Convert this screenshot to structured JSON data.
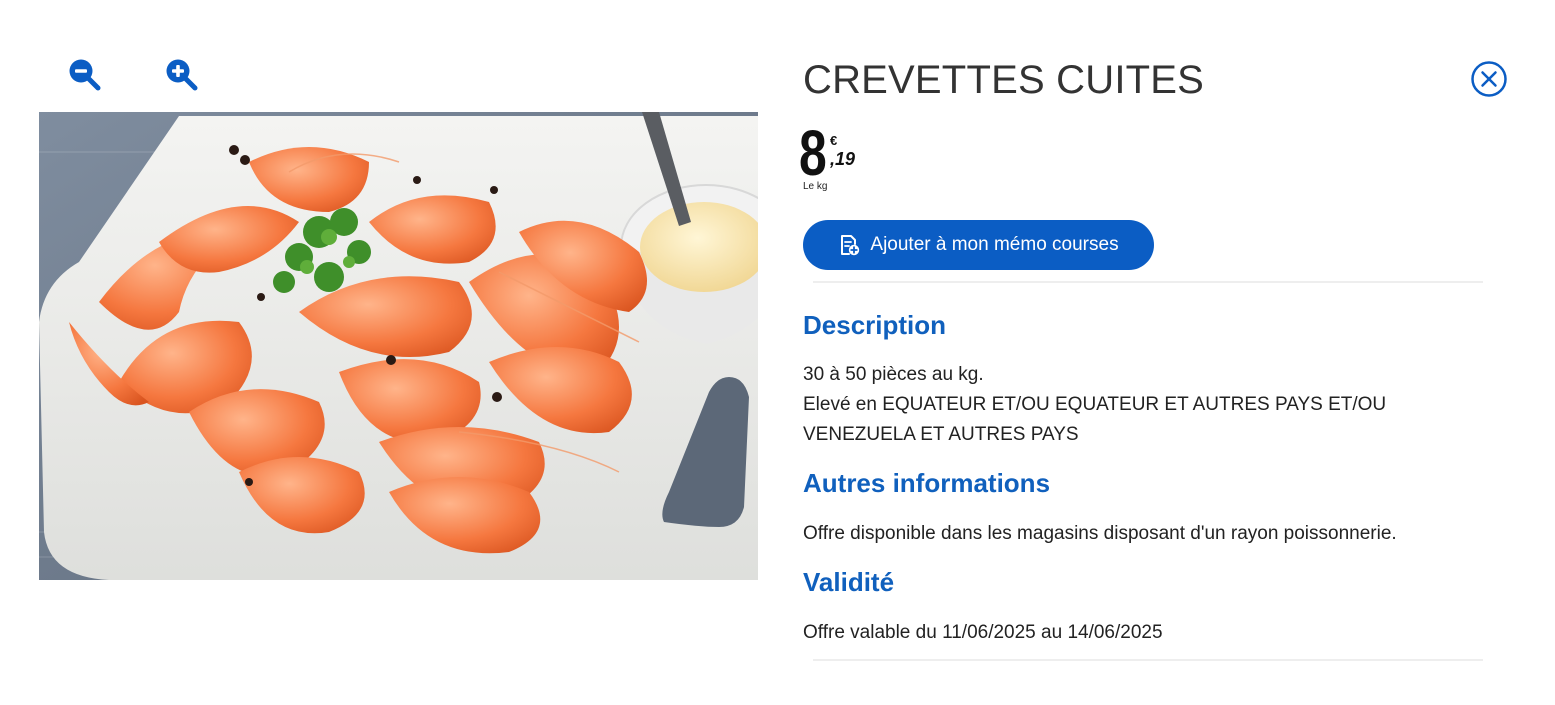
{
  "toolbar": {
    "zoom_out_icon": "zoom-out-icon",
    "zoom_in_icon": "zoom-in-icon",
    "icon_color": "#0b5dc4"
  },
  "product": {
    "title": "CREVETTES CUITES",
    "image_alt": "Crevettes cuites sur planche avec mayonnaise",
    "price": {
      "integer": "8",
      "currency": "€",
      "decimals": ",19",
      "unit": "Le kg"
    },
    "memo_button_label": "Ajouter à mon mémo courses",
    "memo_button_icon": "memo-add-icon",
    "close_icon": "close-circle-icon"
  },
  "sections": {
    "description": {
      "title": "Description",
      "line1": "30 à 50 pièces au kg.",
      "line2": "Elevé en EQUATEUR ET/OU EQUATEUR ET AUTRES PAYS ET/OU VENEZUELA ET AUTRES PAYS"
    },
    "other_info": {
      "title": "Autres informations",
      "text": "Offre disponible dans les magasins disposant d'un rayon poissonnerie."
    },
    "validity": {
      "title": "Validité",
      "text": "Offre valable du 11/06/2025 au 14/06/2025"
    }
  },
  "colors": {
    "accent": "#0b5dc4",
    "section_title": "#1060bd",
    "divider": "#eeeeee"
  }
}
